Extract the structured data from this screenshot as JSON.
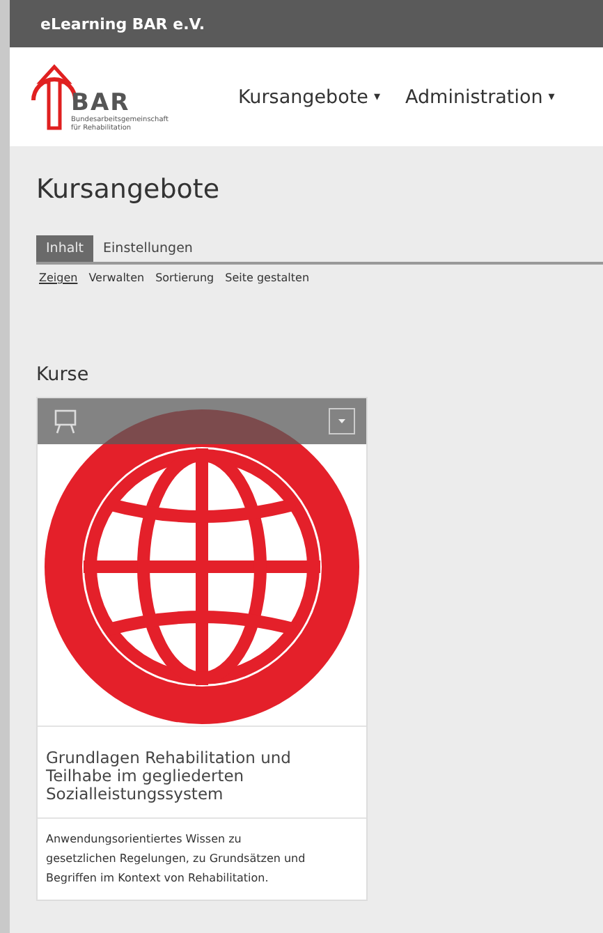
{
  "top_bar": {
    "title": "eLearning BAR e.V."
  },
  "logo": {
    "name": "BAR",
    "subtitle_lines": [
      "Bundesarbeitsgemeinschaft",
      "für Rehabilitation"
    ]
  },
  "nav": [
    {
      "label": "Kursangebote",
      "caret": "▾"
    },
    {
      "label": "Administration",
      "caret": "▾"
    }
  ],
  "page_title": "Kursangebote",
  "tabs": [
    {
      "label": "Inhalt",
      "selected": true
    },
    {
      "label": "Einstellungen",
      "selected": false
    }
  ],
  "subnav": [
    {
      "label": "Zeigen",
      "selected": true
    },
    {
      "label": "Verwalten",
      "selected": false
    },
    {
      "label": "Sortierung",
      "selected": false
    },
    {
      "label": "Seite gestalten",
      "selected": false
    }
  ],
  "section_title": "Kurse",
  "courses": [
    {
      "title": "Grundlagen Rehabilitation und Teilhabe im gegliederten Sozialleistungssystem",
      "description": "Anwendungsorientiertes Wissen zu gesetzlichen Regelungen, zu Grundsätzen und Begriffen im Kontext von Rehabilitation."
    }
  ]
}
